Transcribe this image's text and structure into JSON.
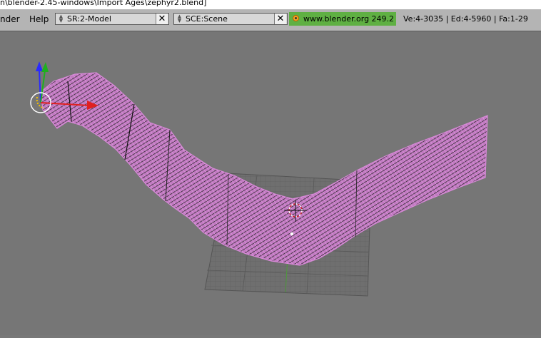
{
  "window": {
    "title": "n\\blender-2.45-windows\\Import Ages\\zephyr2.blend]"
  },
  "menubar": {
    "items": [
      "nder",
      "Help"
    ],
    "screen_field": "SR:2-Model",
    "scene_field": "SCE:Scene",
    "url": "www.blender.org 249.2",
    "stats": "Ve:4-3035 | Ed:4-5960 | Fa:1-29"
  },
  "colors": {
    "mesh_wire": "#d88ad8",
    "mesh_fill": "#b46fb4",
    "grid_line": "#5e5e5e",
    "header_bg": "#b4b4b4",
    "viewport_bg": "#767676",
    "badge_green": "#5fb043"
  },
  "icons": {
    "menu_arrows": "up-down-arrows-icon",
    "close": "close-x-icon",
    "logo": "blender-logo-icon",
    "axis_gizmo": "axis-gizmo-icon",
    "cursor": "3d-cursor-icon"
  }
}
